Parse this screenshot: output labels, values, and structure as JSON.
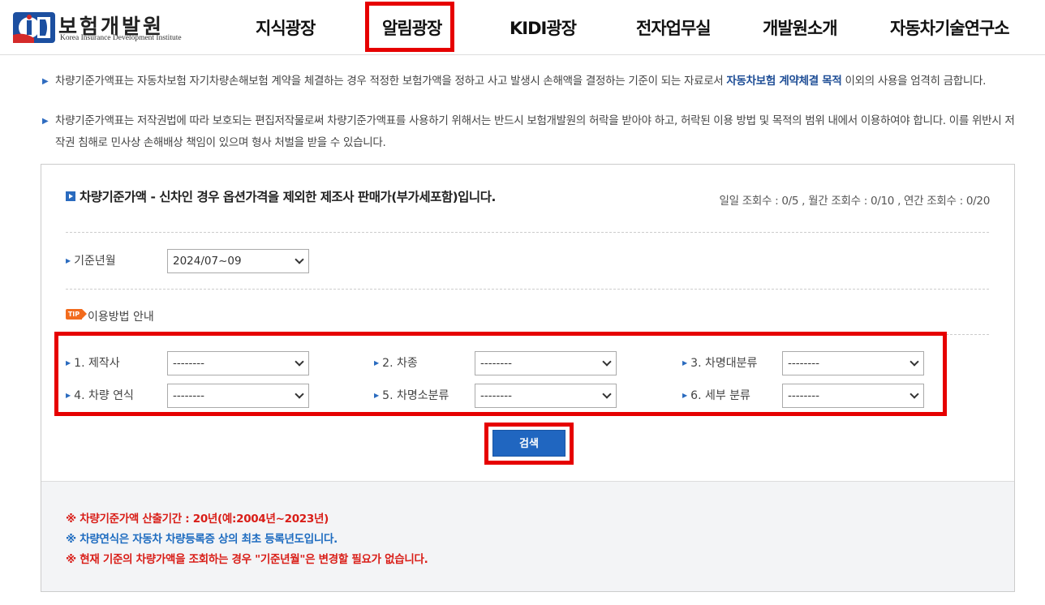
{
  "header": {
    "logo": {
      "ko": "보험개발원",
      "en": "Korea Insurance Development Institute"
    },
    "nav": [
      {
        "label": "지식광장"
      },
      {
        "label": "알림광장"
      },
      {
        "label": "KIDI광장"
      },
      {
        "label": "전자업무실"
      },
      {
        "label": "개발원소개"
      },
      {
        "label": "자동차기술연구소"
      }
    ]
  },
  "notices": {
    "n1_pre": "차량기준가액표는 자동차보험 자기차량손해보험 계약을 체결하는 경우 적정한 보험가액을 정하고 사고 발생시 손해액을 결정하는 기준이 되는 자료로서 ",
    "n1_link": "자동차보험 계약체결 목적",
    "n1_post": " 이외의 사용을 엄격히 금합니다.",
    "n2": "차량기준가액표는 저작권법에 따라 보호되는 편집저작물로써 차량기준가액표를 사용하기 위해서는 반드시 보험개발원의 허락을 받아야 하고, 허락된 이용 방법 및 목적의 범위 내에서 이용하여야 합니다. 이를 위반시 저작권 침해로 민사상 손해배상 책임이 있으며 형사 처벌을 받을 수 있습니다."
  },
  "panel": {
    "title": "차량기준가액 - 신차인 경우 옵션가격을 제외한 제조사 판매가(부가세포함)입니다.",
    "views": "일일 조회수 : 0/5 , 월간 조회수 : 0/10 , 연간 조회수 : 0/20",
    "base_month": {
      "label": "기준년월",
      "value": "2024/07~09"
    },
    "tip": {
      "badge": "TIP",
      "label": "이용방법 안내"
    },
    "filters": [
      {
        "label": "1. 제작사",
        "value": "--------"
      },
      {
        "label": "2. 차종",
        "value": "--------"
      },
      {
        "label": "3. 차명대분류",
        "value": "--------"
      },
      {
        "label": "4. 차량 연식",
        "value": "--------"
      },
      {
        "label": "5. 차명소분류",
        "value": "--------"
      },
      {
        "label": "6. 세부 분류",
        "value": "--------"
      }
    ],
    "search_label": "검색",
    "notes": [
      "※ 차량기준가액 산출기간 : 20년(예:2004년~2023년)",
      "※ 차량연식은 자동차 차량등록증 상의 최초 등록년도입니다.",
      "※ 현재 기준의 차량가액을 조회하는 경우 \"기준년월\"은 변경할 필요가 없습니다."
    ]
  },
  "colors": {
    "accent": "#2066c0",
    "highlight": "#e60000",
    "tip": "#f26b1d"
  }
}
